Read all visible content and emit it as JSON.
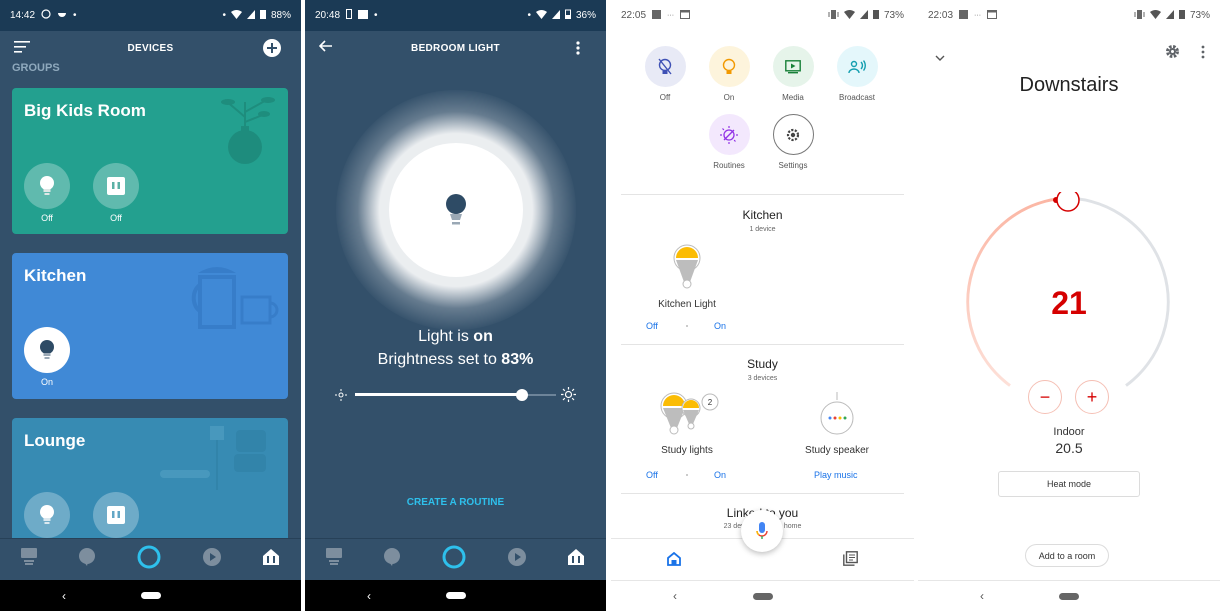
{
  "screen1": {
    "status": {
      "time": "14:42",
      "battery": "88%"
    },
    "header": {
      "title": "DEVICES"
    },
    "groups_label": "GROUPS",
    "groups": [
      {
        "name": "Big Kids Room",
        "color": "#23a08f",
        "devices": [
          {
            "type": "bulb",
            "state": "Off"
          },
          {
            "type": "plug",
            "state": "Off"
          }
        ]
      },
      {
        "name": "Kitchen",
        "color": "#4089d6",
        "devices": [
          {
            "type": "bulb",
            "state": "On"
          }
        ]
      },
      {
        "name": "Lounge",
        "color": "#378bb3",
        "devices": [
          {
            "type": "bulb",
            "state": ""
          },
          {
            "type": "plug",
            "state": ""
          }
        ]
      }
    ],
    "nav": [
      "dashboard",
      "communicate",
      "alexa",
      "play",
      "devices"
    ]
  },
  "screen2": {
    "status": {
      "time": "20:48",
      "battery": "36%"
    },
    "header": {
      "title": "BEDROOM LIGHT"
    },
    "status_line_prefix": "Light is ",
    "status_line_value": "on",
    "brightness_prefix": "Brightness set to ",
    "brightness_value": "83%",
    "brightness_fraction": 0.83,
    "create_routine": "CREATE A ROUTINE"
  },
  "screen3": {
    "status": {
      "time": "22:05",
      "battery": "73%"
    },
    "actions": [
      {
        "label": "Off",
        "icon": "light-off-icon",
        "bg": "#e8eaf6",
        "fg": "#3f51b5"
      },
      {
        "label": "On",
        "icon": "light-on-icon",
        "bg": "#fdf4dc",
        "fg": "#f29900"
      },
      {
        "label": "Media",
        "icon": "media-icon",
        "bg": "#e6f4ea",
        "fg": "#188038"
      },
      {
        "label": "Broadcast",
        "icon": "broadcast-icon",
        "bg": "#e4f7fb",
        "fg": "#129eaf"
      },
      {
        "label": "Routines",
        "icon": "routines-icon",
        "bg": "#f3e8fd",
        "fg": "#9334e6"
      },
      {
        "label": "Settings",
        "icon": "settings-icon",
        "bg": "#ffffff",
        "fg": "#444444"
      }
    ],
    "rooms": [
      {
        "name": "Kitchen",
        "subtitle": "1 device",
        "devices": [
          {
            "name": "Kitchen Light",
            "controls": [
              "Off",
              "On"
            ]
          }
        ]
      },
      {
        "name": "Study",
        "subtitle": "3 devices",
        "devices": [
          {
            "name": "Study lights",
            "badge": "2",
            "controls": [
              "Off",
              "On"
            ]
          },
          {
            "name": "Study speaker",
            "controls": [
              "Play music"
            ]
          }
        ]
      },
      {
        "name": "Linked to you",
        "subtitle": "23 devices not in a home"
      }
    ]
  },
  "screen4": {
    "status": {
      "time": "22:03",
      "battery": "73%"
    },
    "title": "Downstairs",
    "setpoint": "21",
    "minus": "−",
    "plus": "+",
    "indoor_label": "Indoor",
    "indoor_value": "20.5",
    "mode_button": "Heat mode",
    "add_room_button": "Add to a room",
    "accent": "#d50000"
  }
}
